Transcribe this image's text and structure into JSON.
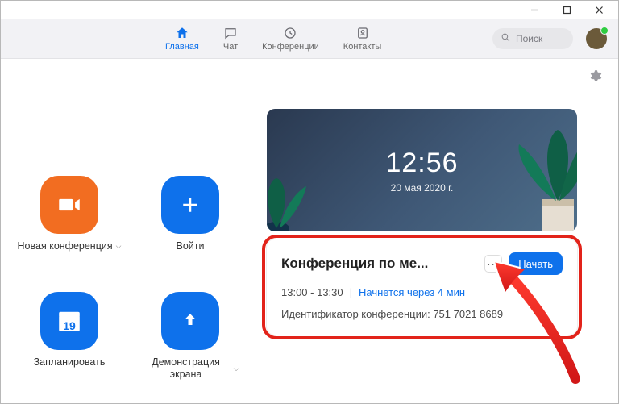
{
  "titlebar": {},
  "header": {
    "tabs": [
      {
        "label": "Главная"
      },
      {
        "label": "Чат"
      },
      {
        "label": "Конференции"
      },
      {
        "label": "Контакты"
      }
    ],
    "search_placeholder": "Поиск"
  },
  "actions": {
    "new_meeting": "Новая конференция",
    "join": "Войти",
    "schedule": "Запланировать",
    "share": "Демонстрация экрана",
    "calendar_day": "19"
  },
  "hero": {
    "time": "12:56",
    "date": "20 мая 2020 г."
  },
  "meeting": {
    "title": "Конференция по ме...",
    "start_button": "Начать",
    "time_range": "13:00 - 13:30",
    "starts_in": "Начнется через 4 мин",
    "id_label": "Идентификатор конференции:",
    "id_value": "751 7021 8689"
  }
}
